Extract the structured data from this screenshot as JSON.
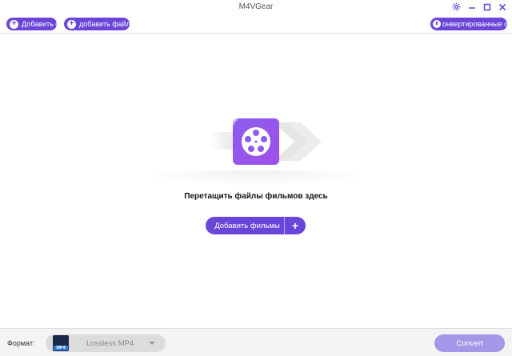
{
  "window": {
    "title": "M4VGear"
  },
  "toolbar": {
    "add_movies_label": "Добавить фи",
    "add_files_label": "добавить файлы",
    "converted_label": "онвертированные фильм"
  },
  "main": {
    "drop_text": "Перетащить файлы фильмов здесь",
    "add_button_label": "Добавить фильмы",
    "add_plus": "+"
  },
  "footer": {
    "format_label": "Формат:",
    "format_value": "Lossless MP4",
    "format_badge": "MP4",
    "convert_label": "Convert"
  },
  "colors": {
    "accent": "#6a45d9",
    "convert_disabled": "#a696e8"
  },
  "icons": [
    "gear-icon",
    "minimize-icon",
    "maximize-icon",
    "close-icon",
    "film-reel-icon",
    "mp4-icon",
    "clock-icon",
    "plus-icon"
  ]
}
